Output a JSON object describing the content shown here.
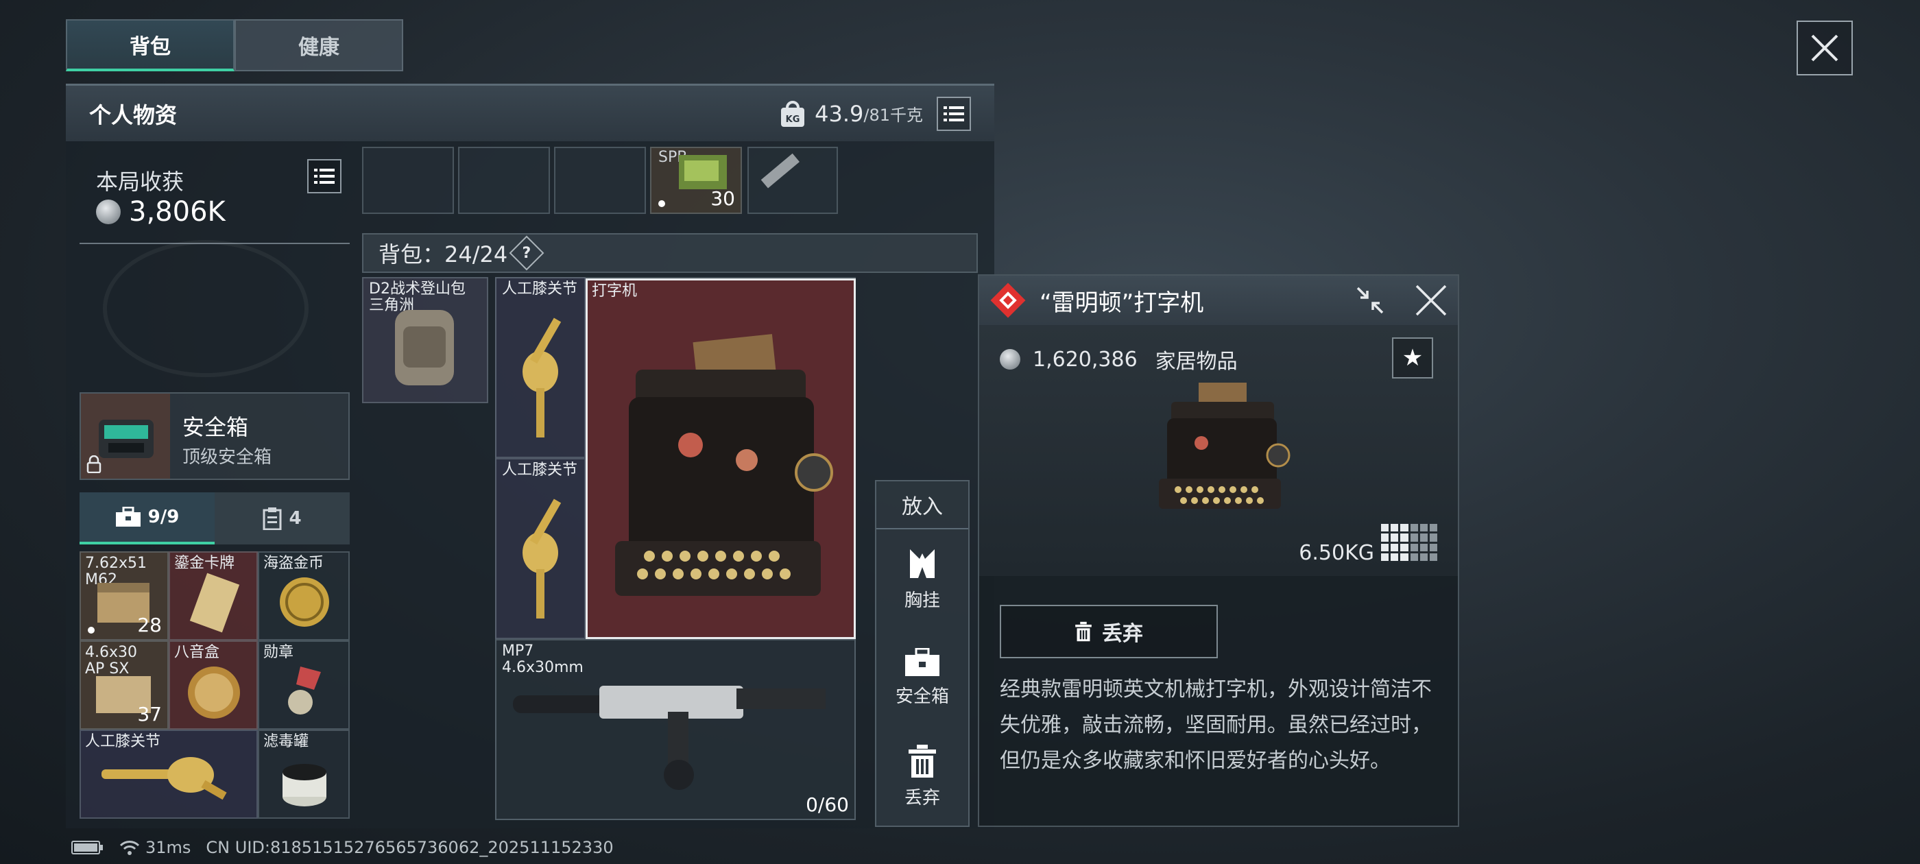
{
  "tabs": {
    "backpack": "背包",
    "health": "健康"
  },
  "header": {
    "title": "个人物资",
    "weight_value": "43.9",
    "weight_max": "/81千克"
  },
  "harvest": {
    "title": "本局收获",
    "value": "3,806K"
  },
  "safebox": {
    "name": "安全箱",
    "subtitle": "顶级安全箱"
  },
  "sub_tabs": {
    "tools_count": "9/9",
    "notes_count": "4"
  },
  "safe_items": [
    {
      "label": "7.62x51\nM62",
      "qty": "28"
    },
    {
      "label": "鎏金卡牌",
      "qty": ""
    },
    {
      "label": "海盗金币",
      "qty": ""
    },
    {
      "label": "4.6x30\nAP SX",
      "qty": "37"
    },
    {
      "label": "八音盒",
      "qty": ""
    },
    {
      "label": "勋章",
      "qty": ""
    },
    {
      "label": "人工膝关节",
      "qty": ""
    },
    {
      "label": "滤毒罐",
      "qty": ""
    }
  ],
  "top_slots": {
    "spb_label": "SPB",
    "spb_qty": "30"
  },
  "bag": {
    "label": "背包：24/24",
    "help": "?",
    "backpack_item": "D2战术登山包\n三角洲",
    "knee1": "人工膝关节",
    "knee2": "人工膝关节",
    "typewriter": "打字机",
    "mp7_label": "MP7\n4.6x30mm",
    "mp7_ammo": "0/60"
  },
  "put_panel": {
    "title": "放入",
    "chest_rig": "胸挂",
    "safebox": "安全箱",
    "discard": "丢弃"
  },
  "detail": {
    "title": "“雷明顿”打字机",
    "price": "1,620,386",
    "category": "家居物品",
    "weight": "6.50KG",
    "discard": "丢弃",
    "description": "经典款雷明顿英文机械打字机，外观设计简洁不失优雅，敲击流畅，坚固耐用。虽然已经过时，但仍是众多收藏家和怀旧爱好者的心头好。",
    "accent_color": "#e0312f"
  },
  "status": {
    "ping": "31ms",
    "uid": "CN UID:818515152765657360​62_202511152330"
  },
  "icons": [
    "close-icon",
    "weight-kg-icon",
    "list-icon",
    "coin-icon",
    "lock-icon",
    "toolbox-icon",
    "clipboard-icon",
    "star-icon",
    "trash-icon",
    "chest-rig-icon",
    "battery-icon",
    "wifi-icon",
    "diamond-icon",
    "minimize-icon"
  ]
}
